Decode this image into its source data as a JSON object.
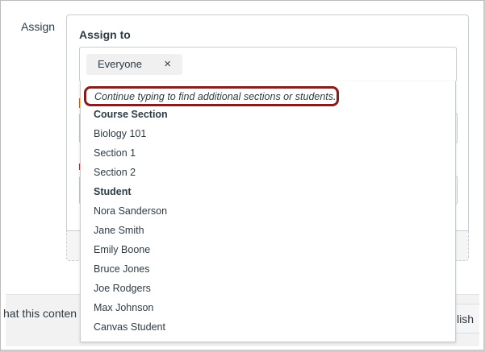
{
  "assign_label": "Assign",
  "assign_to_label": "Assign to",
  "chip": {
    "label": "Everyone",
    "remove_icon": "×"
  },
  "dropdown": {
    "hint": "Continue typing to find additional sections or students.",
    "groups": [
      {
        "header": "Course Section",
        "items": [
          "Biology 101",
          "Section 1",
          "Section 2"
        ]
      },
      {
        "header": "Student",
        "items": [
          "Nora Sanderson",
          "Jane Smith",
          "Emily Boone",
          "Bruce Jones",
          "Joe Rodgers",
          "Max Johnson",
          "Canvas Student"
        ]
      }
    ]
  },
  "footer": {
    "notice_text": "hat this conten",
    "publish_label": "lish"
  },
  "colors": {
    "highlight": "#8b1a1a"
  }
}
